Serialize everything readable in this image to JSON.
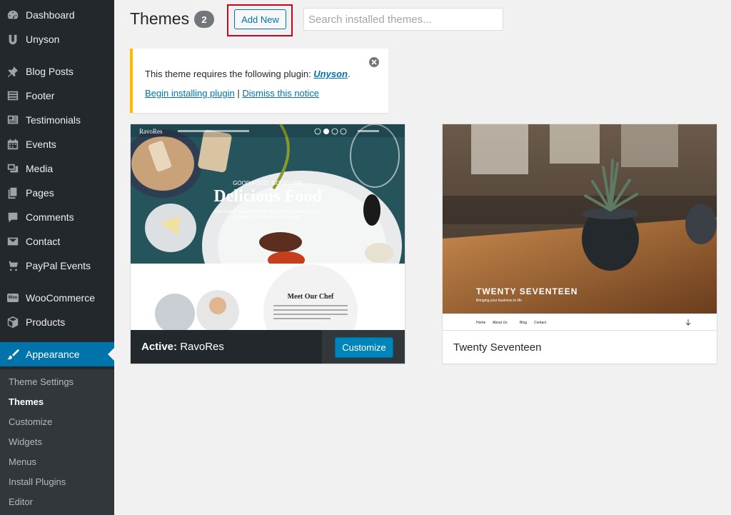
{
  "sidebar": {
    "items": [
      {
        "label": "Dashboard",
        "icon": "dashboard-icon"
      },
      {
        "label": "Unyson",
        "icon": "unyson-icon"
      },
      {
        "label": "Blog Posts",
        "icon": "pin-icon"
      },
      {
        "label": "Footer",
        "icon": "footer-icon"
      },
      {
        "label": "Testimonials",
        "icon": "testimonials-icon"
      },
      {
        "label": "Events",
        "icon": "calendar-icon"
      },
      {
        "label": "Media",
        "icon": "media-icon"
      },
      {
        "label": "Pages",
        "icon": "pages-icon"
      },
      {
        "label": "Comments",
        "icon": "comment-icon"
      },
      {
        "label": "Contact",
        "icon": "mail-icon"
      },
      {
        "label": "PayPal Events",
        "icon": "cart-icon"
      },
      {
        "label": "WooCommerce",
        "icon": "woocommerce-icon"
      },
      {
        "label": "Products",
        "icon": "box-icon"
      },
      {
        "label": "Appearance",
        "icon": "brush-icon"
      }
    ],
    "submenu": [
      {
        "label": "Theme Settings"
      },
      {
        "label": "Themes"
      },
      {
        "label": "Customize"
      },
      {
        "label": "Widgets"
      },
      {
        "label": "Menus"
      },
      {
        "label": "Install Plugins"
      },
      {
        "label": "Editor"
      }
    ],
    "woo_badge": "Woo",
    "active_color": "#0073aa"
  },
  "header": {
    "title": "Themes",
    "count": "2",
    "add_new_label": "Add New",
    "search_placeholder": "Search installed themes..."
  },
  "notice": {
    "text_before": "This theme requires the following plugin: ",
    "plugin_link": "Unyson",
    "text_after": ".",
    "install_link": "Begin installing plugin",
    "separator": " | ",
    "dismiss_link": "Dismiss this notice",
    "accent_color": "#ffb900"
  },
  "themes": [
    {
      "active_prefix": "Active:",
      "name": "RavoRes",
      "customize_label": "Customize",
      "preview": {
        "logo": "RavoRes",
        "tagline": "GOOD FOOD, GOOD LIFE",
        "headline": "Delicious Food",
        "subline_1": "Our master chefs serve the most delicious variety of the",
        "subline_2": "freshest food from all over the world",
        "section_title": "Meet Our Chef"
      }
    },
    {
      "name": "Twenty Seventeen",
      "preview": {
        "title": "TWENTY SEVENTEEN",
        "tagline": "Bringing your business to life",
        "nav": [
          "Home",
          "About Us",
          "Blog",
          "Contact"
        ]
      }
    }
  ]
}
